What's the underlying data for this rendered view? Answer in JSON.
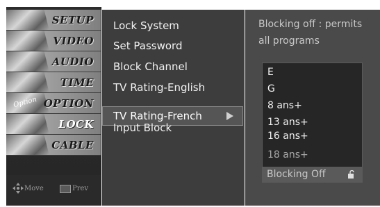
{
  "nav": {
    "items": [
      {
        "label": "SETUP",
        "selected": false
      },
      {
        "label": "VIDEO",
        "selected": false
      },
      {
        "label": "AUDIO",
        "selected": false
      },
      {
        "label": "TIME",
        "selected": false
      },
      {
        "label": "OPTION",
        "selected": false
      },
      {
        "label": "LOCK",
        "selected": true
      },
      {
        "label": "CABLE",
        "selected": false
      }
    ],
    "option_thumb_text": "Option",
    "footer": {
      "move_label": "Move",
      "prev_label": "Prev"
    }
  },
  "menu": {
    "items": [
      {
        "label": "Lock System"
      },
      {
        "label": "Set Password"
      },
      {
        "label": "Block Channel"
      },
      {
        "label": "TV Rating-English"
      },
      {
        "label": "TV Rating-French",
        "selected": true
      },
      {
        "label": "Input Block"
      }
    ]
  },
  "panel": {
    "description_line1": "Blocking off : permits",
    "description_line2": "all programs",
    "ratings": [
      "E",
      "G",
      "8 ans+",
      "13 ans+",
      "16 ans+",
      "18 ans+"
    ],
    "status_label": "Blocking Off"
  },
  "colors": {
    "menu_bg": "#3d3d3d",
    "panel_bg": "#4a4a4a",
    "selected_border": "#8a8a8a"
  }
}
